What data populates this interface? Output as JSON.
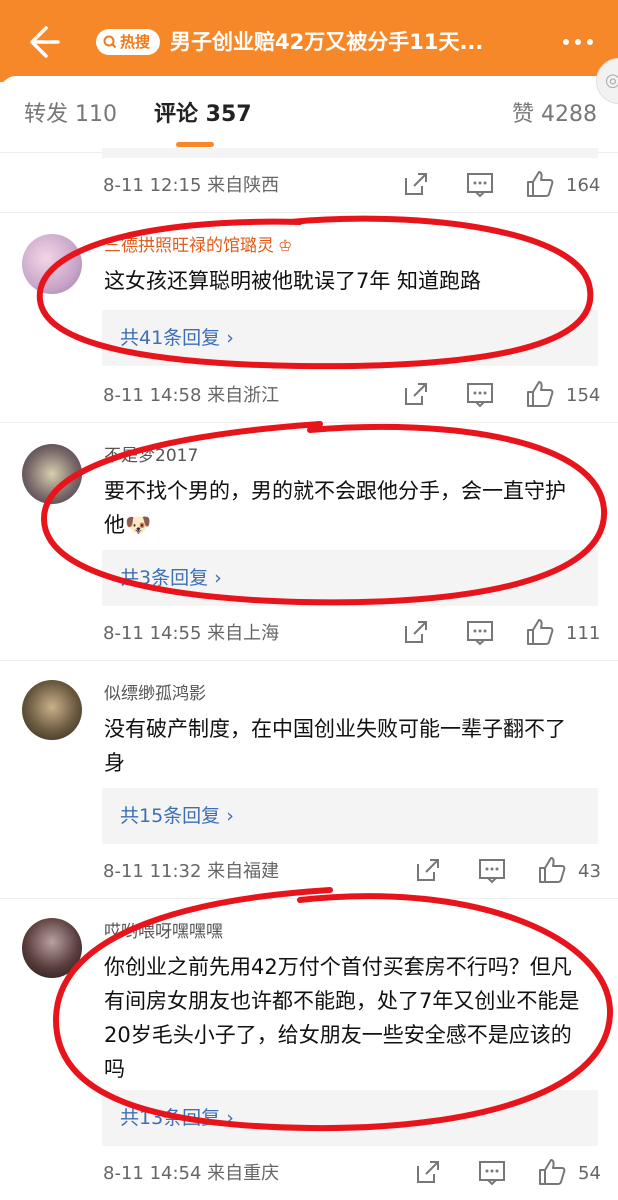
{
  "header": {
    "back_icon": "back-arrow-icon",
    "hot_badge": "热搜",
    "title": "男子创业赔42万又被分手11天...",
    "more_icon": "more-dots-icon",
    "colors": {
      "bar": "#f7882a",
      "link": "#3d6fb5"
    }
  },
  "tabs": [
    {
      "label": "转发 110"
    },
    {
      "label": "评论 357"
    },
    {
      "label": "赞 4288"
    }
  ],
  "top_meta": {
    "time": "8-11 12:15 来自陕西",
    "likes": "164"
  },
  "comments": [
    {
      "user": "三德拱照旺禄的馆璐灵",
      "badge_icon": "crown-icon",
      "text": "这女孩还算聪明被他耽误了7年  知道跑路",
      "replies": "共41条回复 ›",
      "time": "8-11 14:58 来自浙江",
      "likes": "154"
    },
    {
      "user": "不是梦2017",
      "text": "要不找个男的，男的就不会跟他分手，会一直守护他🐶",
      "replies": "共3条回复 ›",
      "time": "8-11 14:55 来自上海",
      "likes": "111"
    },
    {
      "user": "似缥缈孤鸿影",
      "text": "没有破产制度，在中国创业失败可能一辈子翻不了身",
      "replies": "共15条回复 ›",
      "time": "8-11 11:32 来自福建",
      "likes": "43"
    },
    {
      "user": "哎哟喂呀嘿嘿嘿",
      "text": "你创业之前先用42万付个首付买套房不行吗？但凡有间房女朋友也许都不能跑，处了7年又创业不能是20岁毛头小子了，给女朋友一些安全感不是应该的吗",
      "replies": "共13条回复 ›",
      "time": "8-11 14:54 来自重庆",
      "likes": "54"
    }
  ]
}
